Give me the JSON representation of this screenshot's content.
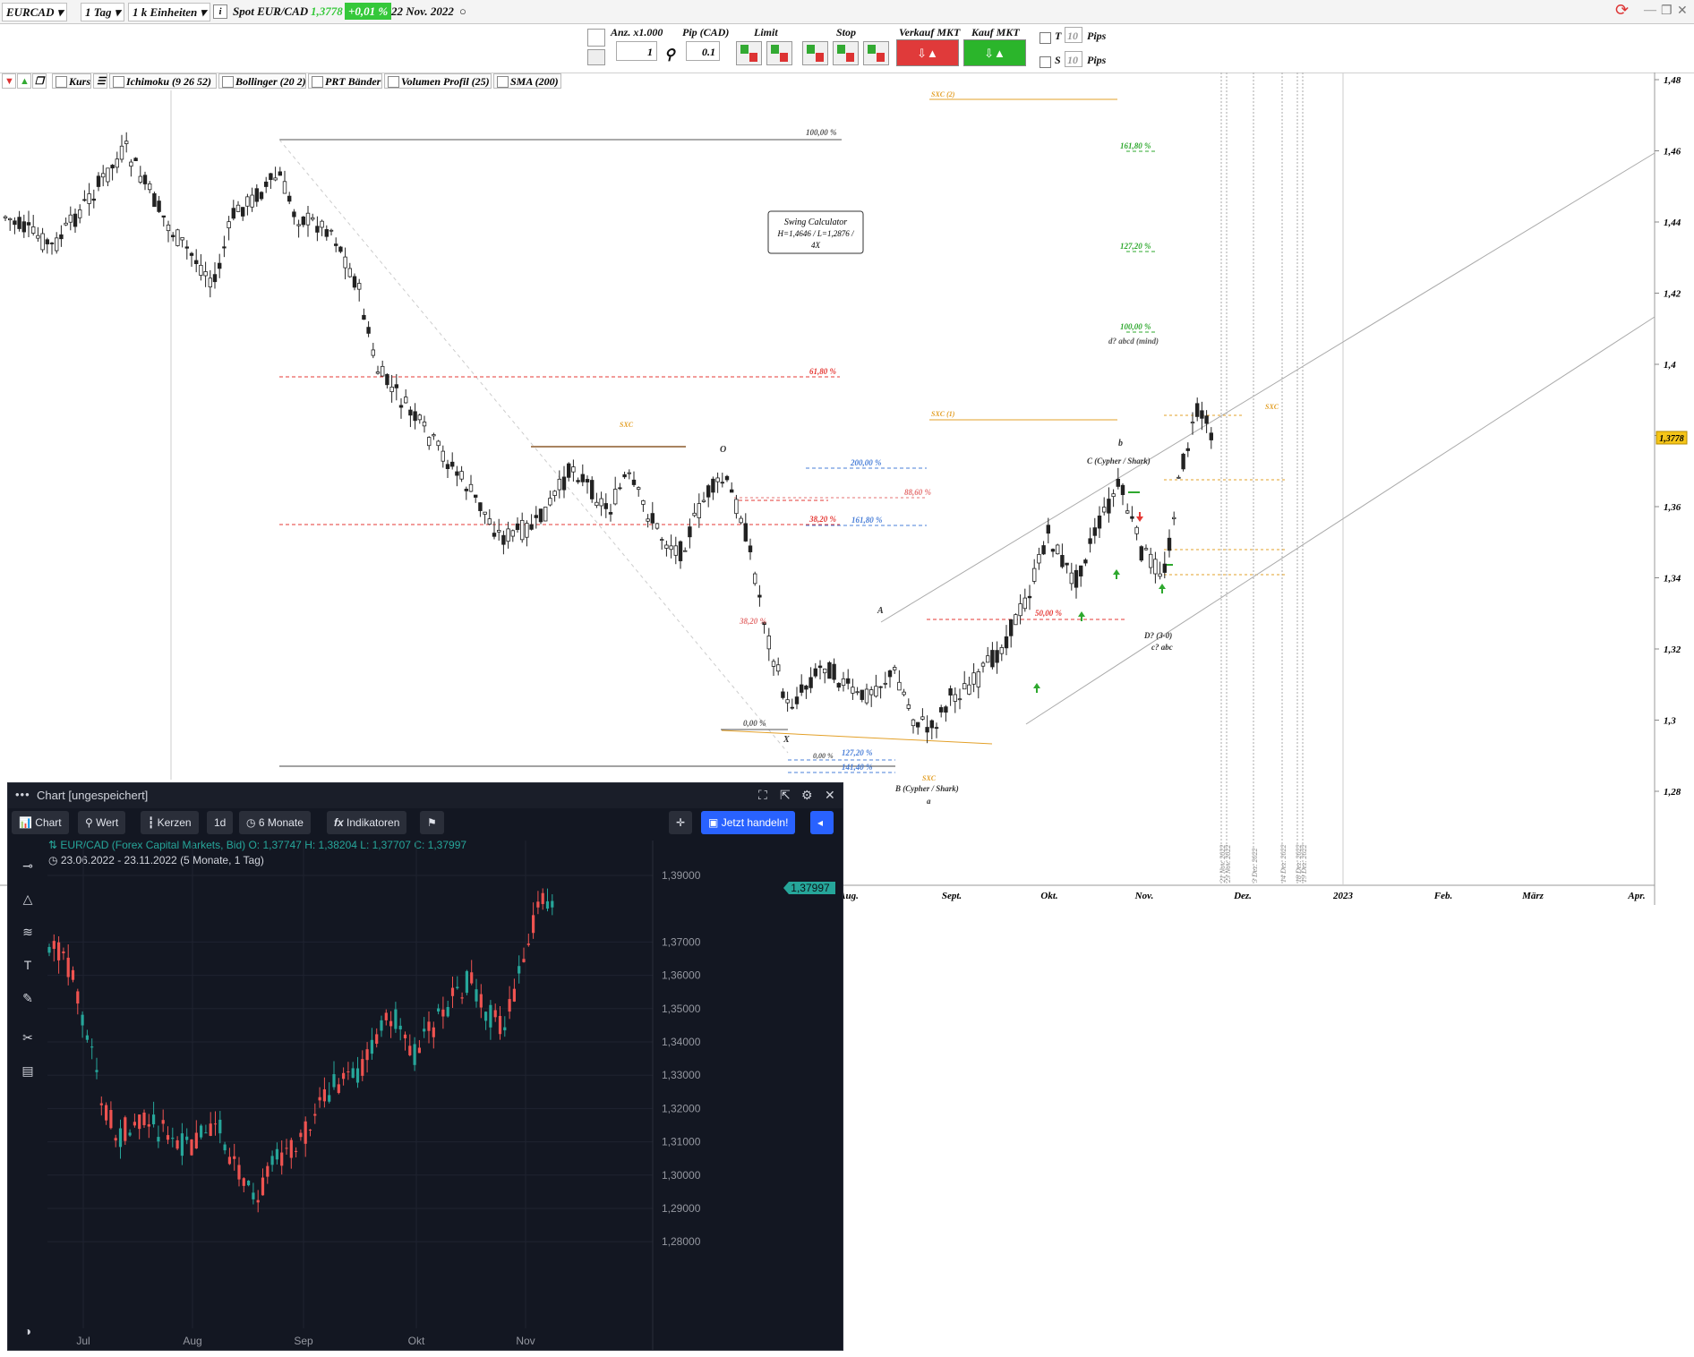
{
  "topbar": {
    "symbol": "EURCAD",
    "timeframe": "1 Tag",
    "units": "1 k Einheiten",
    "spot_label": "Spot EUR/CAD",
    "spot_price": "1,3778",
    "change": "+0,01 %",
    "date": "22 Nov. 2022"
  },
  "tradebar": {
    "qty_label": "Anz. x1.000",
    "qty_value": "1",
    "pip_label": "Pip (CAD)",
    "pip_value": "0.1",
    "limit_label": "Limit",
    "stop_label": "Stop",
    "sell_label": "Verkauf MKT",
    "buy_label": "Kauf MKT",
    "t_label": "T",
    "t_value": "10",
    "t_unit": "Pips",
    "s_label": "S",
    "s_value": "10",
    "s_unit": "Pips"
  },
  "indicators": [
    "Kurs",
    "Ichimoku (9 26 52)",
    "Bollinger (20 2)",
    "PRT Bänder",
    "Volumen Profil (25)",
    "SMA (200)"
  ],
  "main": {
    "price_badge": "1,3778",
    "swing_box": [
      "Swing Calculator",
      "H=1,4646 / L=1,2876 /",
      "4X"
    ],
    "y_ticks": [
      "1,48",
      "1,46",
      "1,44",
      "1,42",
      "1,4",
      "1,38",
      "1,36",
      "1,34",
      "1,32",
      "1,3",
      "1,28"
    ],
    "x_ticks": [
      "Aug.",
      "Sept.",
      "Okt.",
      "Nov.",
      "Dez.",
      "2023",
      "Feb.",
      "März",
      "Apr."
    ],
    "fib_labels": {
      "f100": "100,00 %",
      "f618": "61,80 %",
      "f382a": "38,20 %",
      "f382b": "38,20 %",
      "f2": "200,00 %",
      "f1618": "161,80 %",
      "f886": "88,60 %",
      "f0a": "0,00 %",
      "f0b": "0,00 %",
      "f1272": "127,20 %",
      "f1414": "141,40 %",
      "g1618": "161,80 %",
      "g1272": "127,20 %",
      "g100": "100,00 %",
      "r50": "50,00 %",
      "sxc1": "SXC (2)",
      "sxc2": "SXC (1)",
      "sxc3": "SXC",
      "sxc4": "SXC",
      "sxc5": "SXC"
    },
    "pattern_labels": {
      "o": "O",
      "a": "A",
      "x": "X",
      "b": "b",
      "c": "C (Cypher / Shark)",
      "bcs": "B (Cypher / Shark)",
      "sa": "a",
      "d": "D? (3-0)",
      "cabc": "c? abc",
      "abcd": "d? abcd (mind)"
    },
    "vlabels": [
      "21 Nov. 2022",
      "23 Nov. 2022",
      "3 Dez. 2022",
      "14 Dez. 2022",
      "18 Dez. 2022",
      "19 Dez. 2022"
    ]
  },
  "panel": {
    "title": "Chart [ungespeichert]",
    "btn_chart": "Chart",
    "btn_wert": "Wert",
    "btn_kerzen": "Kerzen",
    "btn_interval": "1d",
    "btn_range": "6 Monate",
    "btn_ind": "Indikatoren",
    "btn_trade": "Jetzt handeln!",
    "info_symbol": "EUR/CAD (Forex Capital Markets, Bid)",
    "info_o": "O: 1,37747",
    "info_h": "H: 1,38204",
    "info_l": "L: 1,37707",
    "info_c": "C: 1,37997",
    "info_range": "23.06.2022 - 23.11.2022",
    "info_period": "(5 Monate, 1 Tag)",
    "price_badge": "1,37997",
    "y_ticks": [
      "1,39000",
      "1,37000",
      "1,36000",
      "1,35000",
      "1,34000",
      "1,33000",
      "1,32000",
      "1,31000",
      "1,30000",
      "1,29000",
      "1,28000"
    ],
    "x_ticks": [
      "Jul",
      "Aug",
      "Sep",
      "Okt",
      "Nov"
    ]
  },
  "colors": {
    "up_main": "#222222",
    "down_main": "#ffffff",
    "up_dark": "#26a69a",
    "down_dark": "#ef5350",
    "fib_red": "#e53935",
    "fib_blue": "#4a7fd8",
    "fib_green": "#2ea82e",
    "sxc_orange": "#e3a028",
    "panel_accent": "#2962ff"
  }
}
